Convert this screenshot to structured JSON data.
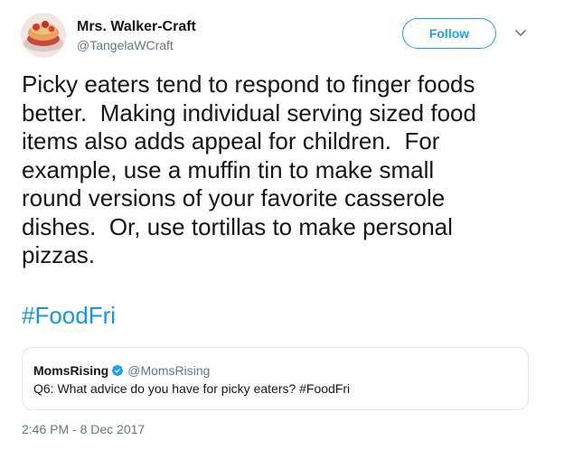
{
  "author": {
    "display_name": "Mrs. Walker-Craft",
    "handle": "@TangelaWCraft"
  },
  "actions": {
    "follow_label": "Follow",
    "menu_icon": "chevron-down-icon"
  },
  "tweet": {
    "text": "Picky eaters tend to respond to finger foods\nbetter.  Making individual serving sized food\nitems also adds appeal for children.  For\nexample, use a muffin tin to make small\nround versions of your favorite casserole\ndishes.  Or, use tortillas to make personal\npizzas.",
    "hashtag": "#FoodFri",
    "timestamp": "2:46 PM - 8 Dec 2017"
  },
  "quoted_tweet": {
    "display_name": "MomsRising",
    "verified_icon": "verified-badge-icon",
    "handle": "@MomsRising",
    "text": "Q6: What advice do you have for picky eaters? #FoodFri"
  },
  "colors": {
    "accent": "#1da1f2",
    "hashtag": "#1b95e0",
    "secondary_text": "#657786",
    "border": "#e1e8ed"
  }
}
